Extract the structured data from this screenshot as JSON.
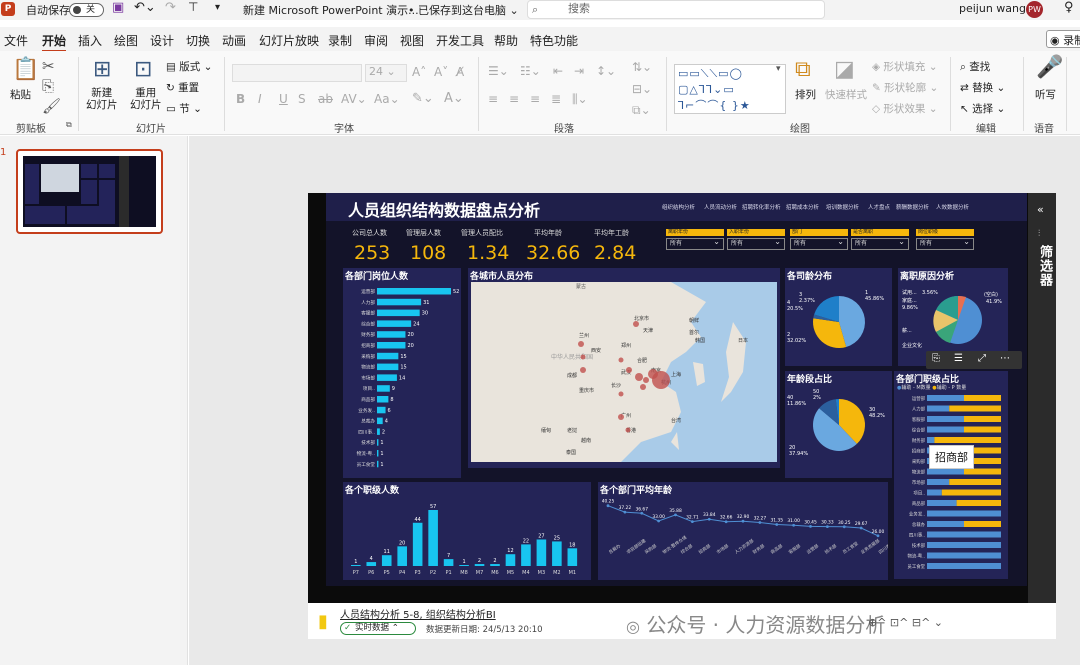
{
  "titlebar": {
    "autosave_label": "自动保存",
    "autosave_state": "关",
    "doc_title": "新建 Microsoft PowerPoint 演示...",
    "save_status": "• 已保存到这台电脑",
    "search_placeholder": "搜索",
    "user_name": "peijun wang",
    "user_initials": "PW"
  },
  "tabs": [
    "文件",
    "开始",
    "插入",
    "绘图",
    "设计",
    "切换",
    "动画",
    "幻灯片放映",
    "录制",
    "审阅",
    "视图",
    "开发工具",
    "帮助",
    "特色功能"
  ],
  "record_button": "录制",
  "ribbon": {
    "paste": "粘贴",
    "new_slide": "新建\n幻灯片",
    "reuse_slide": "重用\n幻灯片",
    "layout": "版式",
    "reset": "重置",
    "section": "节",
    "font_size": "24",
    "arrange": "排列",
    "quick_styles": "快速样式",
    "shape_fill": "形状填充",
    "shape_outline": "形状轮廓",
    "shape_effects": "形状效果",
    "find": "查找",
    "replace": "替换",
    "select": "选择",
    "dictate": "听写",
    "groups": {
      "clipboard": "剪贴板",
      "slides": "幻灯片",
      "font": "字体",
      "paragraph": "段落",
      "drawing": "绘图",
      "editing": "编辑",
      "voice": "语音"
    }
  },
  "slide_number": "1",
  "dashboard": {
    "title": "人员组织结构数据盘点分析",
    "nav": [
      "组织结构分析",
      "人员流动分析",
      "招聘转化率分析",
      "招聘成本分析",
      "培训数据分析",
      "人才盘点",
      "薪酬数据分析",
      "人效数据分析"
    ],
    "kpis": [
      {
        "label": "公司总人数",
        "value": "253"
      },
      {
        "label": "管理层人数",
        "value": "108"
      },
      {
        "label": "管理人员配比",
        "value": "1.34"
      },
      {
        "label": "平均年龄",
        "value": "32.66"
      },
      {
        "label": "平均年工龄",
        "value": "2.84"
      }
    ],
    "filters": [
      {
        "label": "离职年份",
        "value": "所有"
      },
      {
        "label": "入职年份",
        "value": "所有"
      },
      {
        "label": "部门",
        "value": "所有"
      },
      {
        "label": "是否离职",
        "value": "所有"
      },
      {
        "label": "岗位职级",
        "value": "所有"
      }
    ],
    "filter_pane_label": "筛选器",
    "tooltip": "招商部",
    "panels": {
      "dept_headcount": "各部门岗位人数",
      "city_map": "各城市人员分布",
      "tenure": "各司龄分布",
      "leave_reasons": "离职原因分析",
      "age": "年龄段占比",
      "rank_ratio": "各部门职级占比",
      "rank_count": "各个职级人数",
      "dept_avg_age": "各个部门平均年龄"
    },
    "map_labels": [
      "蒙古",
      "中华人民共和国",
      "北京市",
      "天津",
      "日本",
      "朝鲜",
      "韩国",
      "首尔",
      "上海",
      "南京",
      "杭州",
      "重庆市",
      "成都",
      "西安",
      "郑州",
      "武汉",
      "广州",
      "香港",
      "台湾",
      "缅甸",
      "越南",
      "泰国",
      "老挝",
      "兰州",
      "合肥",
      "长沙"
    ],
    "rank_legend": [
      "辅助 - M数量",
      "辅助 - P 数量"
    ],
    "leave_labels": [
      "试用...",
      "3.56%",
      "(空白)",
      "家庭...",
      "9.86%",
      "41.9%",
      "薪...",
      "企业文化"
    ]
  },
  "bottombar": {
    "report_name": "人员结构分析 5-8, 组织结构分析BI",
    "live_badge": "实时数据",
    "update_time": "数据更新日期: 24/5/13 20:10",
    "watermark": "公众号 · 人力资源数据分析"
  },
  "chart_data": [
    {
      "type": "bar",
      "title": "各部门岗位人数",
      "categories": [
        "运营部",
        "人力部",
        "客服部",
        "综合部",
        "财务部",
        "招商部",
        "采购部",
        "物流部",
        "市场部",
        "项目..",
        "商品部",
        "业务发..",
        "总裁办",
        "四川事..",
        "技术部",
        "物流-粤..",
        "员工食堂"
      ],
      "values": [
        52,
        31,
        30,
        24,
        20,
        20,
        15,
        15,
        14,
        9,
        8,
        6,
        4,
        2,
        1,
        1,
        1
      ]
    },
    {
      "type": "bar",
      "title": "各个职级人数",
      "categories": [
        "P7",
        "P6",
        "P5",
        "P4",
        "P3",
        "P2",
        "P1",
        "M8",
        "M7",
        "M6",
        "M5",
        "M4",
        "M3",
        "M2",
        "M1"
      ],
      "values": [
        1,
        4,
        11,
        20,
        44,
        57,
        7,
        1,
        2,
        2,
        12,
        22,
        27,
        25,
        18
      ]
    },
    {
      "type": "line",
      "title": "各个部门平均年龄",
      "categories": [
        "总裁办",
        "项目部组建",
        "采购部",
        "物流-整体仓储",
        "综合部",
        "招商部",
        "市场部",
        "人力资源部",
        "财务部",
        "商品部",
        "客服部",
        "运营部",
        "技术部",
        "员工食堂",
        "业务发展部",
        "四川事业部"
      ],
      "values": [
        40.25,
        37.22,
        36.67,
        33.0,
        35.88,
        32.71,
        33.84,
        32.66,
        32.9,
        32.27,
        31.35,
        31.0,
        30.45,
        30.33,
        30.25,
        29.67,
        26.0
      ]
    },
    {
      "type": "pie",
      "title": "各司龄分布",
      "categories": [
        "1",
        "2",
        "3",
        "4"
      ],
      "values": [
        45.86,
        32.02,
        2.37,
        20.5
      ]
    },
    {
      "type": "pie",
      "title": "年龄段占比",
      "categories": [
        "20",
        "30",
        "40",
        "50"
      ],
      "values": [
        37.94,
        48.2,
        11.86,
        2.0
      ]
    }
  ]
}
